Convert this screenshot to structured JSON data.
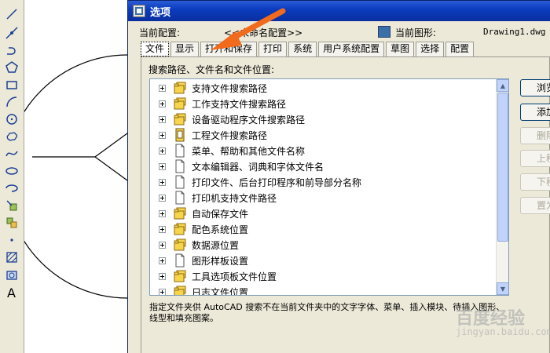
{
  "dialog": {
    "title": "选项",
    "current_profile_label": "当前配置:",
    "current_profile_value": "<<未命名配置>>",
    "current_drawing_label": "当前图形:",
    "current_drawing_value": "Drawing1.dwg"
  },
  "tabs": [
    {
      "label": "文件",
      "active": true
    },
    {
      "label": "显示"
    },
    {
      "label": "打开和保存"
    },
    {
      "label": "打印"
    },
    {
      "label": "系统"
    },
    {
      "label": "用户系统配置"
    },
    {
      "label": "草图"
    },
    {
      "label": "选择"
    },
    {
      "label": "配置"
    }
  ],
  "files_tab": {
    "heading": "搜索路径、文件名和文件位置:",
    "tree_items": [
      {
        "label": "支持文件搜索路径",
        "icon": "folder-stack-icon"
      },
      {
        "label": "工作支持文件搜索路径",
        "icon": "folder-stack-icon"
      },
      {
        "label": "设备驱动程序文件搜索路径",
        "icon": "folder-stack-icon"
      },
      {
        "label": "工程文件搜索路径",
        "icon": "project-file-icon"
      },
      {
        "label": "菜单、帮助和其他文件名称",
        "icon": "document-icon"
      },
      {
        "label": "文本编辑器、词典和字体文件名",
        "icon": "document-icon"
      },
      {
        "label": "打印文件、后台打印程序和前导部分名称",
        "icon": "document-icon"
      },
      {
        "label": "打印机支持文件路径",
        "icon": "document-icon"
      },
      {
        "label": "自动保存文件",
        "icon": "folder-stack-icon"
      },
      {
        "label": "配色系统位置",
        "icon": "folder-stack-icon"
      },
      {
        "label": "数据源位置",
        "icon": "folder-stack-icon"
      },
      {
        "label": "图形样板设置",
        "icon": "document-icon"
      },
      {
        "label": "工具选项板文件位置",
        "icon": "folder-stack-icon"
      },
      {
        "label": "日志文件位置",
        "icon": "folder-stack-icon"
      }
    ],
    "description": "指定文件夹供 AutoCAD 搜索不在当前文件夹中的文字字体、菜单、插入模块、待插入图形、线型和填充图案。"
  },
  "side_buttons": [
    {
      "label": "浏览",
      "enabled": true
    },
    {
      "label": "添加",
      "enabled": true
    },
    {
      "label": "删除",
      "enabled": false
    },
    {
      "label": "上移",
      "enabled": false
    },
    {
      "label": "下移",
      "enabled": false
    },
    {
      "label": "置为",
      "enabled": false
    }
  ],
  "watermark": {
    "text": "百度经验",
    "url": "jingyan.baidu.com"
  },
  "colors": {
    "title_bar": "#0b3dbf",
    "dialog_bg": "#ece9d8",
    "arrow": "#f26a1b",
    "folder_yellow": "#f7d54b"
  }
}
